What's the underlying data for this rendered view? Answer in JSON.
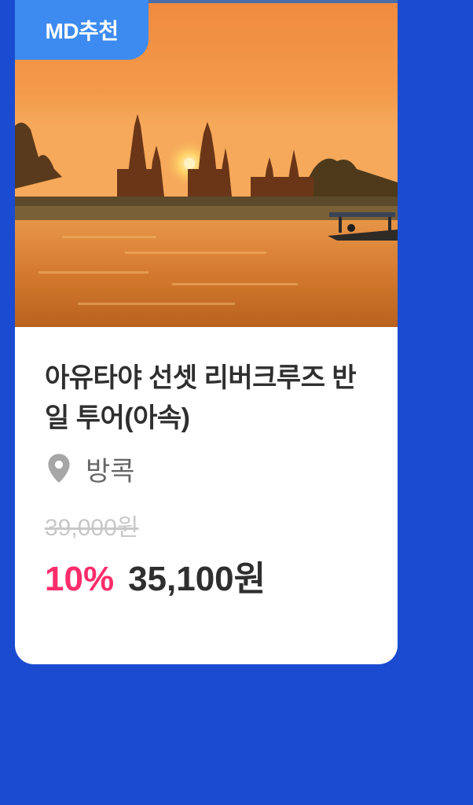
{
  "card": {
    "badge": "MD추천",
    "title": "아유타야 선셋 리버크루즈 반일 투어(아속)",
    "location_icon": "location-pin-icon",
    "location": "방콕",
    "original_price": "39,000원",
    "discount": "10%",
    "sale_price": "35,100원",
    "image_alt": "Ayutthaya temple sunset over river with longtail boat"
  },
  "colors": {
    "background": "#1b4bd0",
    "badge": "#3d8bf0",
    "discount": "#ff2d6b",
    "title": "#2f2f2f"
  }
}
